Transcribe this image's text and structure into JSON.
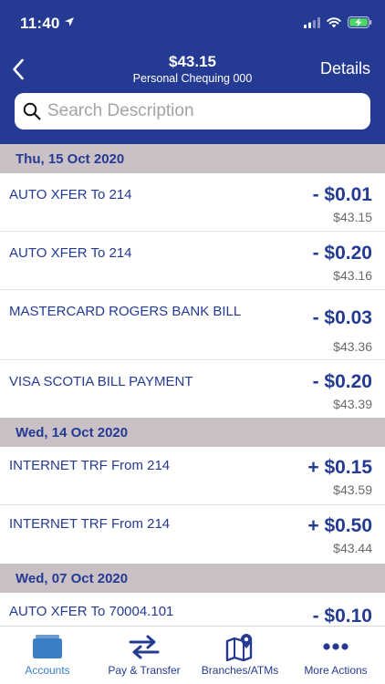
{
  "status_bar": {
    "time": "11:40"
  },
  "header": {
    "balance": "$43.15",
    "account_name": "Personal Chequing 000",
    "details_label": "Details"
  },
  "search": {
    "placeholder": "Search Description",
    "value": ""
  },
  "groups": [
    {
      "date": "Thu, 15 Oct 2020",
      "transactions": [
        {
          "description": "AUTO XFER To 214",
          "amount": "- $0.01",
          "balance": "$43.15"
        },
        {
          "description": "AUTO XFER To 214",
          "amount": "- $0.20",
          "balance": "$43.16"
        },
        {
          "description": "MASTERCARD ROGERS BANK BILL",
          "amount": "- $0.03",
          "balance": "$43.36"
        },
        {
          "description": "VISA SCOTIA BILL PAYMENT",
          "amount": "- $0.20",
          "balance": "$43.39"
        }
      ]
    },
    {
      "date": "Wed, 14 Oct 2020",
      "transactions": [
        {
          "description": "INTERNET TRF From 214",
          "amount": "+ $0.15",
          "balance": "$43.59"
        },
        {
          "description": "INTERNET TRF From 214",
          "amount": "+ $0.50",
          "balance": "$43.44"
        }
      ]
    },
    {
      "date": "Wed, 07 Oct 2020",
      "transactions": [
        {
          "description": "AUTO XFER To  70004.101",
          "amount": "- $0.10",
          "balance": ""
        }
      ]
    }
  ],
  "tabs": [
    {
      "label": "Accounts",
      "icon": "wallet-icon",
      "active": true
    },
    {
      "label": "Pay & Transfer",
      "icon": "transfer-arrows-icon",
      "active": false
    },
    {
      "label": "Branches/ATMs",
      "icon": "map-pin-icon",
      "active": false
    },
    {
      "label": "More Actions",
      "icon": "more-dots-icon",
      "active": false
    }
  ],
  "colors": {
    "header_bg": "#253a93",
    "date_header_bg": "#c9c1c6",
    "text_primary": "#253a93",
    "tab_active": "#3a7ec6",
    "battery_fill": "#4cd964"
  }
}
